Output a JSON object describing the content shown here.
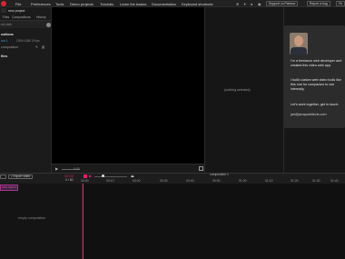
{
  "menu": {
    "items": [
      "File",
      "Preferences",
      "Tools",
      "Demo projects",
      "Tutorials",
      "Learn the basics",
      "Documentation",
      "Keyboard shortcuts"
    ],
    "support_label": "Support on Patreon",
    "report_label": "Report a bug",
    "feature_label": "Fe"
  },
  "tooltip": {
    "text": "Learn the basics"
  },
  "left_panel": {
    "project_name": "new project",
    "tabs": [
      "Files",
      "Compositions",
      "History"
    ],
    "search_hint": "ed click",
    "section_title": "ositions",
    "comp_name": "ion 1",
    "comp_size": "1920×1080 30 fps",
    "comp_sub": "composition",
    "files_title": "files"
  },
  "player": {
    "time": "0:00"
  },
  "right_panel": {
    "empty_text": "(nothing selected)"
  },
  "promo": {
    "line1": "I'm a freelance web developer and created this video web app.",
    "line2": "I build custom web video tools like this one for companies to use internally.",
    "line3": "Let's work together, get in touch:",
    "email": "jan@janaparbitects.com"
  },
  "timeline": {
    "export_label": "Export video",
    "time_display": "00:00",
    "frame_display": "0 / 60",
    "comp_title": "composition 1",
    "ticks": [
      "00:00",
      "00:10",
      "00:20",
      "00:30",
      "00:40",
      "00:50",
      "01:00",
      "01:10",
      "01:20",
      "01:30",
      "01:40"
    ],
    "btn_left": "",
    "tab_label": "new layers",
    "empty_text": "empty composition"
  },
  "colors": {
    "accent": "#e0206f",
    "brand": "#e0202f",
    "link": "#2f8fd8"
  }
}
